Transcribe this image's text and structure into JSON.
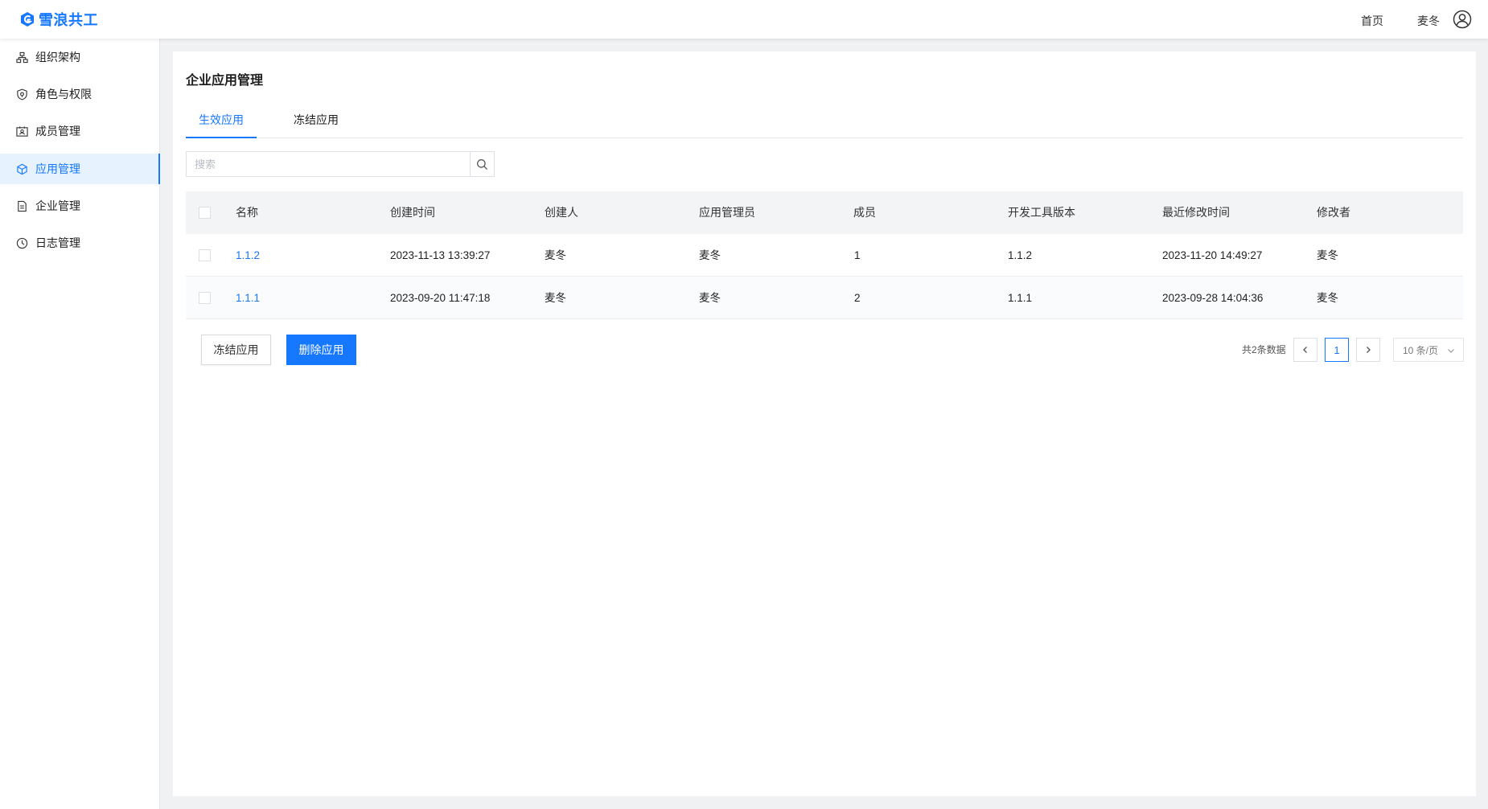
{
  "header": {
    "logo_text": "雪浪共工",
    "home_label": "首页",
    "user_name": "麦冬"
  },
  "sidebar": {
    "items": [
      {
        "label": "组织架构",
        "icon": "org-chart-icon",
        "active": false
      },
      {
        "label": "角色与权限",
        "icon": "shield-icon",
        "active": false
      },
      {
        "label": "成员管理",
        "icon": "id-card-icon",
        "active": false
      },
      {
        "label": "应用管理",
        "icon": "cube-icon",
        "active": true
      },
      {
        "label": "企业管理",
        "icon": "document-icon",
        "active": false
      },
      {
        "label": "日志管理",
        "icon": "clock-icon",
        "active": false
      }
    ]
  },
  "main": {
    "title": "企业应用管理",
    "tabs": [
      {
        "label": "生效应用",
        "active": true
      },
      {
        "label": "冻结应用",
        "active": false
      }
    ],
    "search": {
      "placeholder": "搜索",
      "value": ""
    },
    "table": {
      "columns": [
        "名称",
        "创建时间",
        "创建人",
        "应用管理员",
        "成员",
        "开发工具版本",
        "最近修改时间",
        "修改者"
      ],
      "rows": [
        [
          "1.1.2",
          "2023-11-13 13:39:27",
          "麦冬",
          "麦冬",
          "1",
          "1.1.2",
          "2023-11-20 14:49:27",
          "麦冬"
        ],
        [
          "1.1.1",
          "2023-09-20 11:47:18",
          "麦冬",
          "麦冬",
          "2",
          "1.1.1",
          "2023-09-28 14:04:36",
          "麦冬"
        ]
      ]
    },
    "actions": {
      "freeze_label": "冻结应用",
      "delete_label": "删除应用"
    },
    "pagination": {
      "total_text": "共2条数据",
      "current_page": "1",
      "page_size": "10 条/页"
    }
  },
  "colors": {
    "accent": "#1677ff",
    "header_row": "#f3f4f6",
    "active_menu_bg": "#e6f3ff"
  }
}
